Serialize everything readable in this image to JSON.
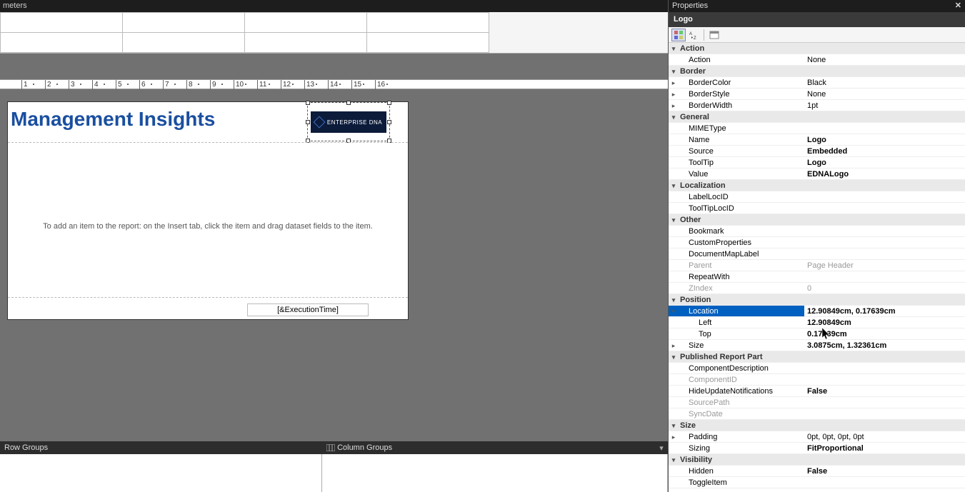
{
  "topbar": {
    "params_label": "meters"
  },
  "groups": {
    "row_label": "Row Groups",
    "col_label": "Column Groups"
  },
  "report": {
    "title": "Management Insights",
    "logo_text": "ENTERPRISE DNA",
    "placeholder": "To add an item to the report: on the Insert tab, click the item and drag dataset fields to the item.",
    "exec_time": "[&ExecutionTime]"
  },
  "props": {
    "panel_title": "Properties",
    "object_name": "Logo",
    "rows": [
      {
        "t": "cat",
        "toggle": "v",
        "name": "Action"
      },
      {
        "t": "p",
        "indent": 1,
        "name": "Action",
        "val": "None"
      },
      {
        "t": "cat",
        "toggle": "v",
        "name": "Border"
      },
      {
        "t": "p",
        "indent": 1,
        "toggle": ">",
        "name": "BorderColor",
        "val": "Black"
      },
      {
        "t": "p",
        "indent": 1,
        "toggle": ">",
        "name": "BorderStyle",
        "val": "None"
      },
      {
        "t": "p",
        "indent": 1,
        "toggle": ">",
        "name": "BorderWidth",
        "val": "1pt"
      },
      {
        "t": "cat",
        "toggle": "v",
        "name": "General"
      },
      {
        "t": "p",
        "indent": 1,
        "name": "MIMEType",
        "val": ""
      },
      {
        "t": "p",
        "indent": 1,
        "name": "Name",
        "val": "Logo",
        "bold": true
      },
      {
        "t": "p",
        "indent": 1,
        "name": "Source",
        "val": "Embedded",
        "bold": true
      },
      {
        "t": "p",
        "indent": 1,
        "name": "ToolTip",
        "val": "Logo",
        "bold": true
      },
      {
        "t": "p",
        "indent": 1,
        "name": "Value",
        "val": "EDNALogo",
        "bold": true
      },
      {
        "t": "cat",
        "toggle": "v",
        "name": "Localization"
      },
      {
        "t": "p",
        "indent": 1,
        "name": "LabelLocID",
        "val": ""
      },
      {
        "t": "p",
        "indent": 1,
        "name": "ToolTipLocID",
        "val": ""
      },
      {
        "t": "cat",
        "toggle": "v",
        "name": "Other"
      },
      {
        "t": "p",
        "indent": 1,
        "name": "Bookmark",
        "val": ""
      },
      {
        "t": "p",
        "indent": 1,
        "name": "CustomProperties",
        "val": ""
      },
      {
        "t": "p",
        "indent": 1,
        "name": "DocumentMapLabel",
        "val": ""
      },
      {
        "t": "p",
        "indent": 1,
        "name": "Parent",
        "val": "Page Header",
        "muted": true
      },
      {
        "t": "p",
        "indent": 1,
        "name": "RepeatWith",
        "val": ""
      },
      {
        "t": "p",
        "indent": 1,
        "name": "ZIndex",
        "val": "0",
        "muted": true
      },
      {
        "t": "cat",
        "toggle": "v",
        "name": "Position"
      },
      {
        "t": "p",
        "indent": 1,
        "toggle": "v",
        "name": "Location",
        "val": "12.90849cm, 0.17639cm",
        "bold": true,
        "selected": true
      },
      {
        "t": "p",
        "indent": 2,
        "name": "Left",
        "val": "12.90849cm",
        "bold": true
      },
      {
        "t": "p",
        "indent": 2,
        "name": "Top",
        "val": "0.17639cm",
        "bold": true
      },
      {
        "t": "p",
        "indent": 1,
        "toggle": ">",
        "name": "Size",
        "val": "3.0875cm, 1.32361cm",
        "bold": true
      },
      {
        "t": "cat",
        "toggle": "v",
        "name": "Published Report Part"
      },
      {
        "t": "p",
        "indent": 1,
        "name": "ComponentDescription",
        "val": ""
      },
      {
        "t": "p",
        "indent": 1,
        "name": "ComponentID",
        "val": "",
        "muted": true
      },
      {
        "t": "p",
        "indent": 1,
        "name": "HideUpdateNotifications",
        "val": "False",
        "bold": true
      },
      {
        "t": "p",
        "indent": 1,
        "name": "SourcePath",
        "val": "",
        "muted": true
      },
      {
        "t": "p",
        "indent": 1,
        "name": "SyncDate",
        "val": "",
        "muted": true
      },
      {
        "t": "cat",
        "toggle": "v",
        "name": "Size"
      },
      {
        "t": "p",
        "indent": 1,
        "toggle": ">",
        "name": "Padding",
        "val": "0pt, 0pt, 0pt, 0pt"
      },
      {
        "t": "p",
        "indent": 1,
        "name": "Sizing",
        "val": "FitProportional",
        "bold": true
      },
      {
        "t": "cat",
        "toggle": "v",
        "name": "Visibility"
      },
      {
        "t": "p",
        "indent": 1,
        "name": "Hidden",
        "val": "False",
        "bold": true
      },
      {
        "t": "p",
        "indent": 1,
        "name": "ToggleItem",
        "val": ""
      }
    ]
  },
  "ruler_ticks": [
    "1",
    "2",
    "3",
    "4",
    "5",
    "6",
    "7",
    "8",
    "9",
    "10",
    "11",
    "12",
    "13",
    "14",
    "15",
    "16"
  ]
}
